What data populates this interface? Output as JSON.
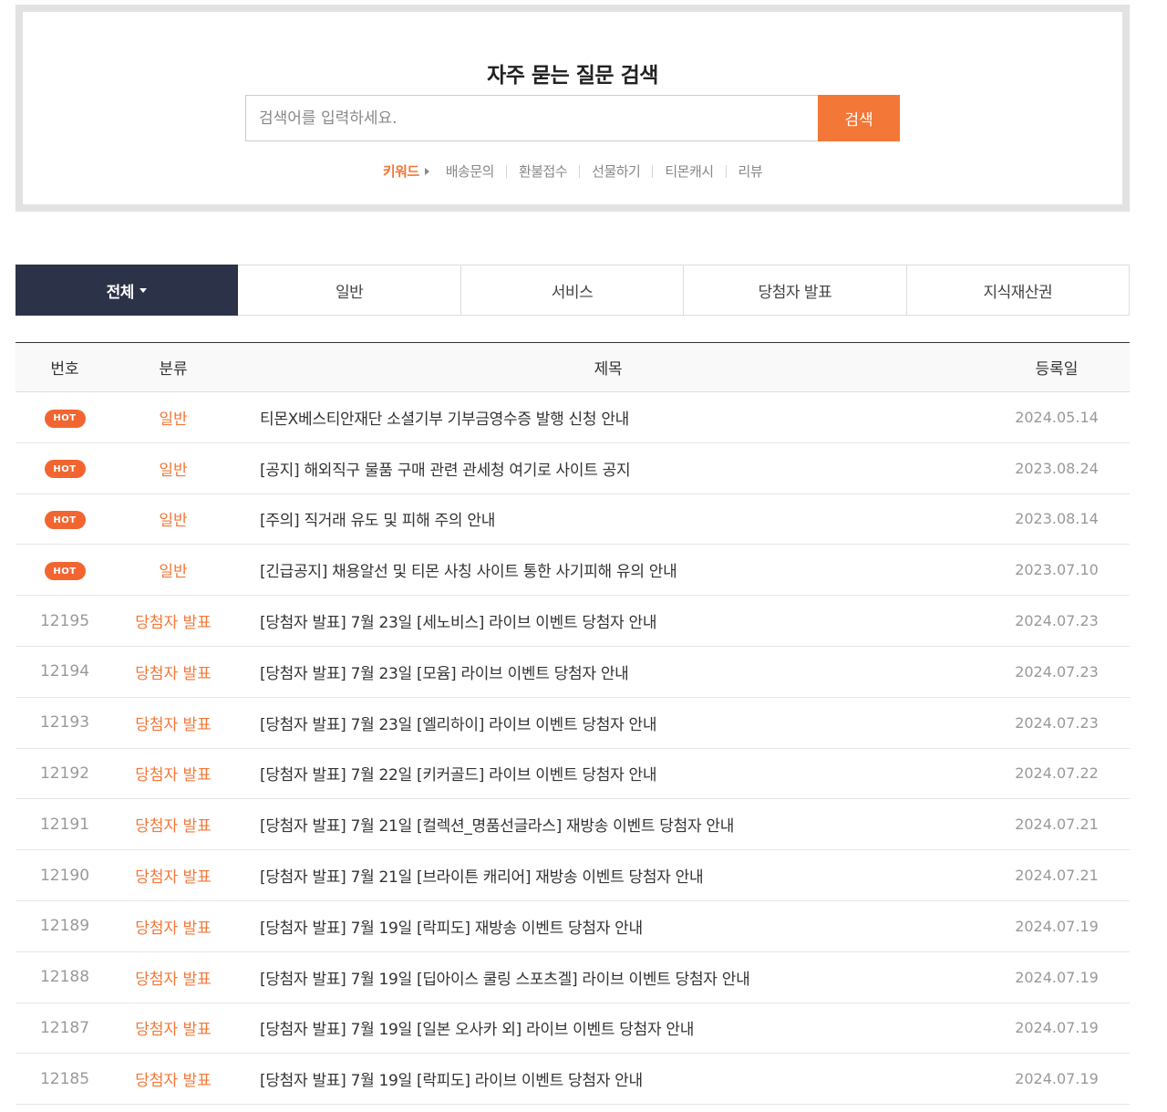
{
  "search": {
    "title": "자주 묻는 질문 검색",
    "placeholder": "검색어를 입력하세요.",
    "button_label": "검색",
    "keyword_label": "키워드",
    "keywords": [
      "배송문의",
      "환불접수",
      "선물하기",
      "티몬캐시",
      "리뷰"
    ]
  },
  "tabs": [
    {
      "label": "전체"
    },
    {
      "label": "일반"
    },
    {
      "label": "서비스"
    },
    {
      "label": "당첨자 발표"
    },
    {
      "label": "지식재산권"
    }
  ],
  "board": {
    "headers": {
      "no": "번호",
      "category": "분류",
      "title": "제목",
      "date": "등록일"
    },
    "hot_label": "HOT",
    "rows": [
      {
        "no": "HOT",
        "category": "일반",
        "title": "티몬X베스티안재단 소셜기부 기부금영수증 발행 신청 안내",
        "date": "2024.05.14"
      },
      {
        "no": "HOT",
        "category": "일반",
        "title": "[공지] 해외직구 물품 구매 관련 관세청 여기로 사이트 공지",
        "date": "2023.08.24"
      },
      {
        "no": "HOT",
        "category": "일반",
        "title": "[주의] 직거래 유도 및 피해 주의 안내",
        "date": "2023.08.14"
      },
      {
        "no": "HOT",
        "category": "일반",
        "title": "[긴급공지] 채용알선 및 티몬 사칭 사이트 통한 사기피해 유의 안내",
        "date": "2023.07.10"
      },
      {
        "no": "12195",
        "category": "당첨자 발표",
        "title": "[당첨자 발표] 7월 23일 [세노비스] 라이브 이벤트 당첨자 안내",
        "date": "2024.07.23"
      },
      {
        "no": "12194",
        "category": "당첨자 발표",
        "title": "[당첨자 발표] 7월 23일 [모윰] 라이브 이벤트 당첨자 안내",
        "date": "2024.07.23"
      },
      {
        "no": "12193",
        "category": "당첨자 발표",
        "title": "[당첨자 발표] 7월 23일 [엘리하이] 라이브 이벤트 당첨자 안내",
        "date": "2024.07.23"
      },
      {
        "no": "12192",
        "category": "당첨자 발표",
        "title": "[당첨자 발표] 7월 22일 [키커골드] 라이브 이벤트 당첨자 안내",
        "date": "2024.07.22"
      },
      {
        "no": "12191",
        "category": "당첨자 발표",
        "title": "[당첨자 발표] 7월 21일 [컬렉션_명품선글라스] 재방송 이벤트 당첨자 안내",
        "date": "2024.07.21"
      },
      {
        "no": "12190",
        "category": "당첨자 발표",
        "title": "[당첨자 발표] 7월 21일 [브라이튼 캐리어] 재방송 이벤트 당첨자 안내",
        "date": "2024.07.21"
      },
      {
        "no": "12189",
        "category": "당첨자 발표",
        "title": "[당첨자 발표] 7월 19일 [락피도] 재방송 이벤트 당첨자 안내",
        "date": "2024.07.19"
      },
      {
        "no": "12188",
        "category": "당첨자 발표",
        "title": "[당첨자 발표] 7월 19일 [딥아이스 쿨링 스포츠겔] 라이브 이벤트 당첨자 안내",
        "date": "2024.07.19"
      },
      {
        "no": "12187",
        "category": "당첨자 발표",
        "title": "[당첨자 발표] 7월 19일 [일본 오사카 외] 라이브 이벤트 당첨자 안내",
        "date": "2024.07.19"
      },
      {
        "no": "12185",
        "category": "당첨자 발표",
        "title": "[당첨자 발표] 7월 19일 [락피도] 라이브 이벤트 당첨자 안내",
        "date": "2024.07.19"
      }
    ]
  },
  "colors": {
    "accent": "#f37737",
    "active_tab": "#2c3248",
    "hot_badge": "#f26531"
  }
}
